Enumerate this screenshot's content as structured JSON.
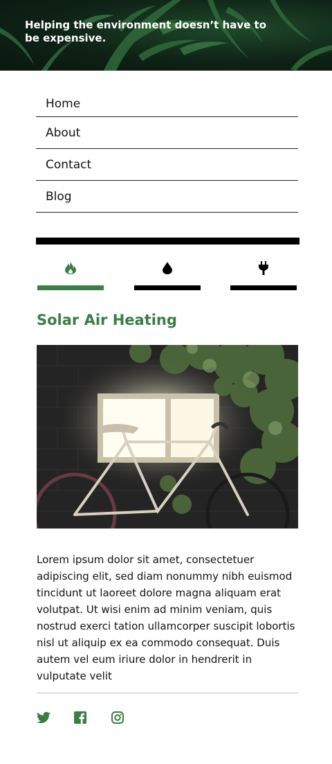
{
  "hero": {
    "tagline": "Helping the environment doesn’t have to be expensive."
  },
  "nav": {
    "items": [
      {
        "label": "Home"
      },
      {
        "label": "About"
      },
      {
        "label": "Contact"
      },
      {
        "label": "Blog"
      }
    ]
  },
  "tabs": [
    {
      "icon": "fire-icon",
      "active": true
    },
    {
      "icon": "water-drop-icon",
      "active": false
    },
    {
      "icon": "plug-icon",
      "active": false
    }
  ],
  "article": {
    "title": "Solar Air Heating",
    "image_description_icon": "bicycle-photo",
    "body": "Lorem ipsum dolor sit amet, consectetuer adipiscing elit, sed diam nonummy nibh euismod tincidunt ut laoreet dolore magna aliquam erat volutpat. Ut wisi enim ad minim veniam, quis nostrud exerci tation ullamcorper suscipit lobortis nisl ut aliquip ex ea commodo consequat. Duis autem vel eum iriure dolor in hendrerit in vulputate velit"
  },
  "social": [
    {
      "icon": "twitter-icon"
    },
    {
      "icon": "facebook-icon"
    },
    {
      "icon": "instagram-icon"
    }
  ],
  "colors": {
    "accent": "#3b7d45",
    "text": "#111111",
    "bar": "#000000"
  }
}
